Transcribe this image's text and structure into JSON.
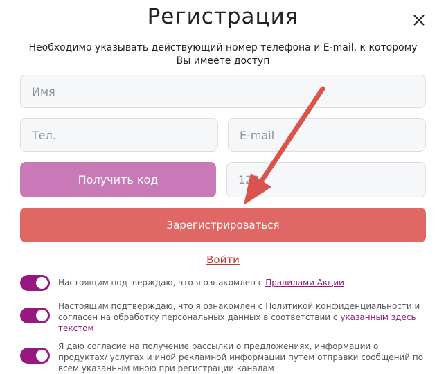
{
  "modal": {
    "title": "Регистрация",
    "subtitle": "Необходимо указывать действующий номер телефона и E-mail, к которому Вы имеете доступ"
  },
  "form": {
    "name_placeholder": "Имя",
    "phone_placeholder": "Тел.",
    "email_placeholder": "E-mail",
    "code_placeholder": "123",
    "get_code_label": "Получить код",
    "register_label": "Зарегистрироваться",
    "login_label": "Войти"
  },
  "consents": [
    {
      "text": "Настоящим подтверждаю, что я ознакомлен с ",
      "link": "Правилами Акции",
      "after": "",
      "checked": true
    },
    {
      "text": "Настоящим подтверждаю, что я ознакомлен с Политикой конфиденциальности и согласен на обработку персональных данных в соответствии с ",
      "link": "указанным здесь текстом",
      "after": "",
      "checked": true
    },
    {
      "text": "Я даю согласие на получение рассылки о предложениях, информации о продуктах/ услугах и иной рекламной информации путем отправки сообщений по всем указанным мною при регистрации каналам",
      "link": "",
      "after": "",
      "checked": true
    }
  ],
  "colors": {
    "get_code_button": "#c978b8",
    "register_button": "#e06864",
    "toggle_on": "#97187f",
    "arrow": "#d9534f",
    "login_link": "#c0392b"
  },
  "icons": {
    "close": "close-icon",
    "arrow": "arrow-annotation"
  }
}
